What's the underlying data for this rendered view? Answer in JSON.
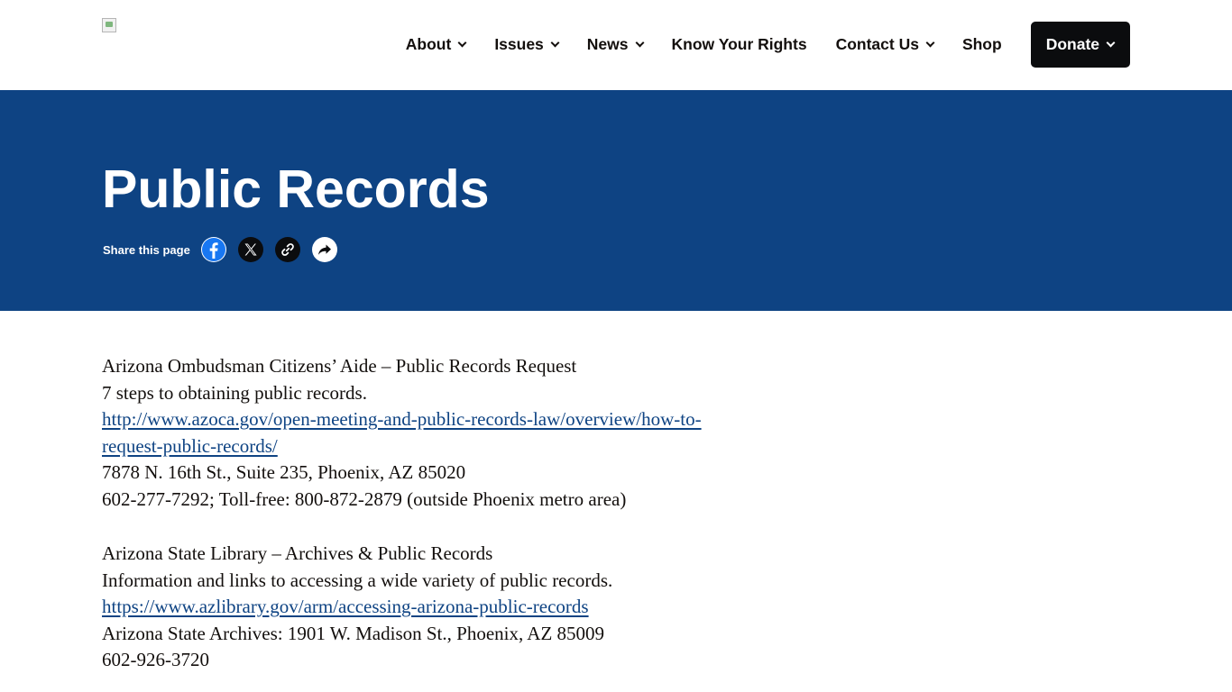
{
  "header": {
    "nav": [
      {
        "label": "About",
        "has_dropdown": true
      },
      {
        "label": "Issues",
        "has_dropdown": true
      },
      {
        "label": "News",
        "has_dropdown": true
      },
      {
        "label": "Know Your Rights",
        "has_dropdown": false
      },
      {
        "label": "Contact Us",
        "has_dropdown": true
      },
      {
        "label": "Shop",
        "has_dropdown": false
      }
    ],
    "donate_label": "Donate"
  },
  "hero": {
    "title": "Public Records",
    "share_label": "Share this page",
    "share_icons": [
      "facebook-icon",
      "x-icon",
      "link-icon",
      "share-forward-icon"
    ],
    "background_color": "#0e4383"
  },
  "content": {
    "entries": [
      {
        "title": "Arizona Ombudsman Citizens’ Aide – Public Records Request",
        "description": "7 steps to obtaining public records.",
        "url_line1": "http://www.azoca.gov/open-meeting-and-public-records-law/overview/how-to-",
        "url_line2": "request-public-records/",
        "address": "7878 N. 16th St., Suite 235, Phoenix, AZ 85020",
        "phone": "602-277-7292; Toll-free: 800-872-2879 (outside Phoenix metro area)"
      },
      {
        "title": "Arizona State Library – Archives & Public Records",
        "description": "Information and links to accessing a wide variety of public records.",
        "url_line1": "https://www.azlibrary.gov/arm/accessing-arizona-public-records",
        "address": "Arizona State Archives: 1901 W. Madison St., Phoenix, AZ 85009",
        "phone": "602-926-3720"
      }
    ]
  },
  "colors": {
    "brand_blue": "#0e4383",
    "donate_bg": "#0b0c0e",
    "link": "#0e4383"
  }
}
